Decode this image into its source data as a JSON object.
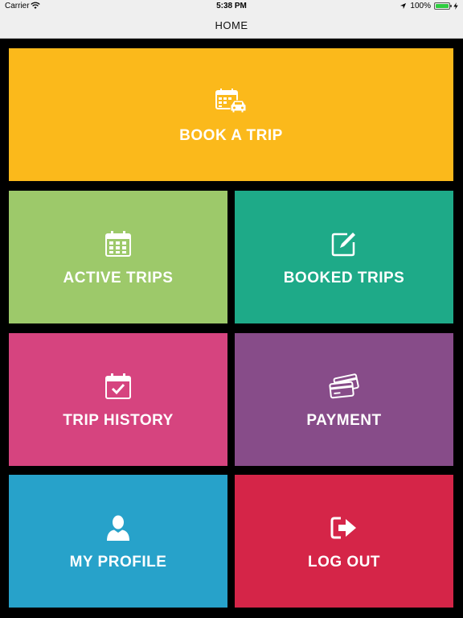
{
  "status_bar": {
    "carrier": "Carrier",
    "time": "5:38 PM",
    "battery_percent": "100%",
    "battery_level": 1.0
  },
  "nav": {
    "title": "HOME"
  },
  "tiles": {
    "book_trip": {
      "label": "BOOK A TRIP",
      "icon": "calendar-car-icon",
      "color": "#fbb91b"
    },
    "active_trips": {
      "label": "ACTIVE TRIPS",
      "icon": "calendar-icon",
      "color": "#9dc96a"
    },
    "booked_trips": {
      "label": "BOOKED TRIPS",
      "icon": "edit-icon",
      "color": "#1eaa88"
    },
    "trip_history": {
      "label": "TRIP HISTORY",
      "icon": "calendar-check-icon",
      "color": "#d6447f"
    },
    "payment": {
      "label": "PAYMENT",
      "icon": "credit-cards-icon",
      "color": "#874c89"
    },
    "my_profile": {
      "label": "MY PROFILE",
      "icon": "user-icon",
      "color": "#27a2ca"
    },
    "log_out": {
      "label": "LOG OUT",
      "icon": "sign-out-icon",
      "color": "#d52548"
    }
  }
}
